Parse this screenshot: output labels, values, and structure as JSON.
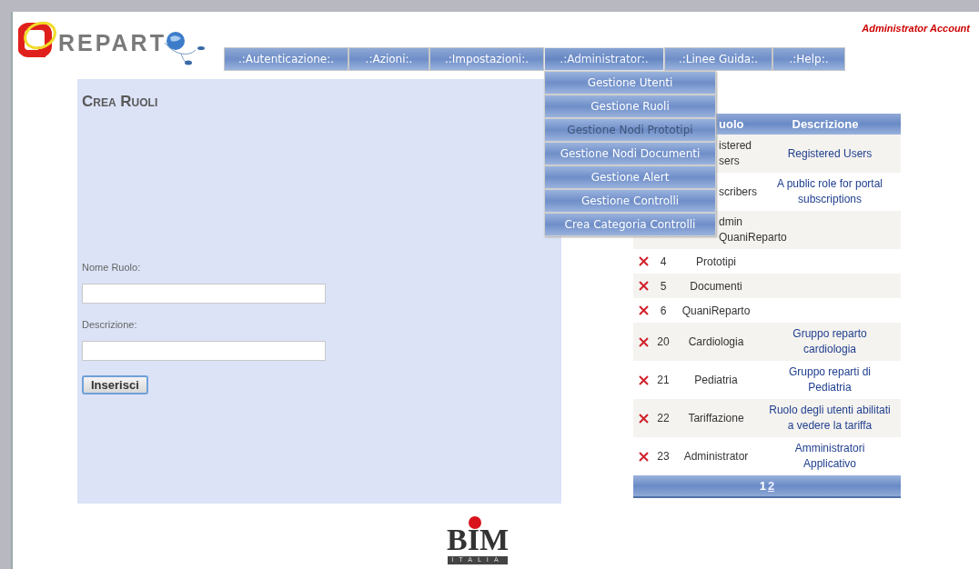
{
  "account": "Administrator Account",
  "logo": {
    "text": "REPART"
  },
  "menu": [
    {
      "label": ".:Autenticazione:.",
      "selected": false
    },
    {
      "label": ".:Azioni:.",
      "selected": false
    },
    {
      "label": ".:Impostazioni:.",
      "selected": false
    },
    {
      "label": ".:Administrator:.",
      "selected": true
    },
    {
      "label": ".:Linee Guida:.",
      "selected": false
    },
    {
      "label": ".:Help:.",
      "selected": false
    }
  ],
  "dropdown": [
    {
      "label": "Gestione Utenti",
      "selected": false
    },
    {
      "label": "Gestione Ruoli",
      "selected": false
    },
    {
      "label": "Gestione Nodi Prototipi",
      "selected": true
    },
    {
      "label": "Gestione Nodi Documenti",
      "selected": false
    },
    {
      "label": "Gestione Alert",
      "selected": false
    },
    {
      "label": "Gestione Controlli",
      "selected": false
    },
    {
      "label": "Crea Categoria Controlli",
      "selected": false
    }
  ],
  "form": {
    "title": "Crea Ruoli",
    "fields": [
      {
        "label": "Nome Ruolo:"
      },
      {
        "label": "Descrizione:"
      }
    ],
    "button": "Inserisci"
  },
  "table": {
    "columns": [
      "uolo",
      "Descrizione"
    ],
    "rows": [
      {
        "role": "istered sers",
        "description": "Registered Users"
      },
      {
        "role": "scribers",
        "description": "A public role for portal subscriptions"
      },
      {
        "role": "dmin QuaniReparto"
      },
      {
        "id": "4",
        "role": "Prototipi"
      },
      {
        "id": "5",
        "role": "Documenti"
      },
      {
        "id": "6",
        "role": "QuaniReparto"
      },
      {
        "id": "20",
        "role": "Cardiologia",
        "description": "Gruppo reparto cardiologia"
      },
      {
        "id": "21",
        "role": "Pediatria",
        "description": "Gruppo reparti di Pediatria"
      },
      {
        "id": "22",
        "role": "Tariffazione",
        "description": "Ruolo degli utenti abilitati a vedere la tariffa"
      },
      {
        "id": "23",
        "role": "Administrator",
        "description": "Amministratori Applicativo"
      }
    ],
    "pages": [
      {
        "label": "1",
        "selected": true
      },
      {
        "label": "2",
        "selected": false
      }
    ]
  },
  "footer_logo": {
    "text": "BIM",
    "subtext": "ITALIA"
  }
}
